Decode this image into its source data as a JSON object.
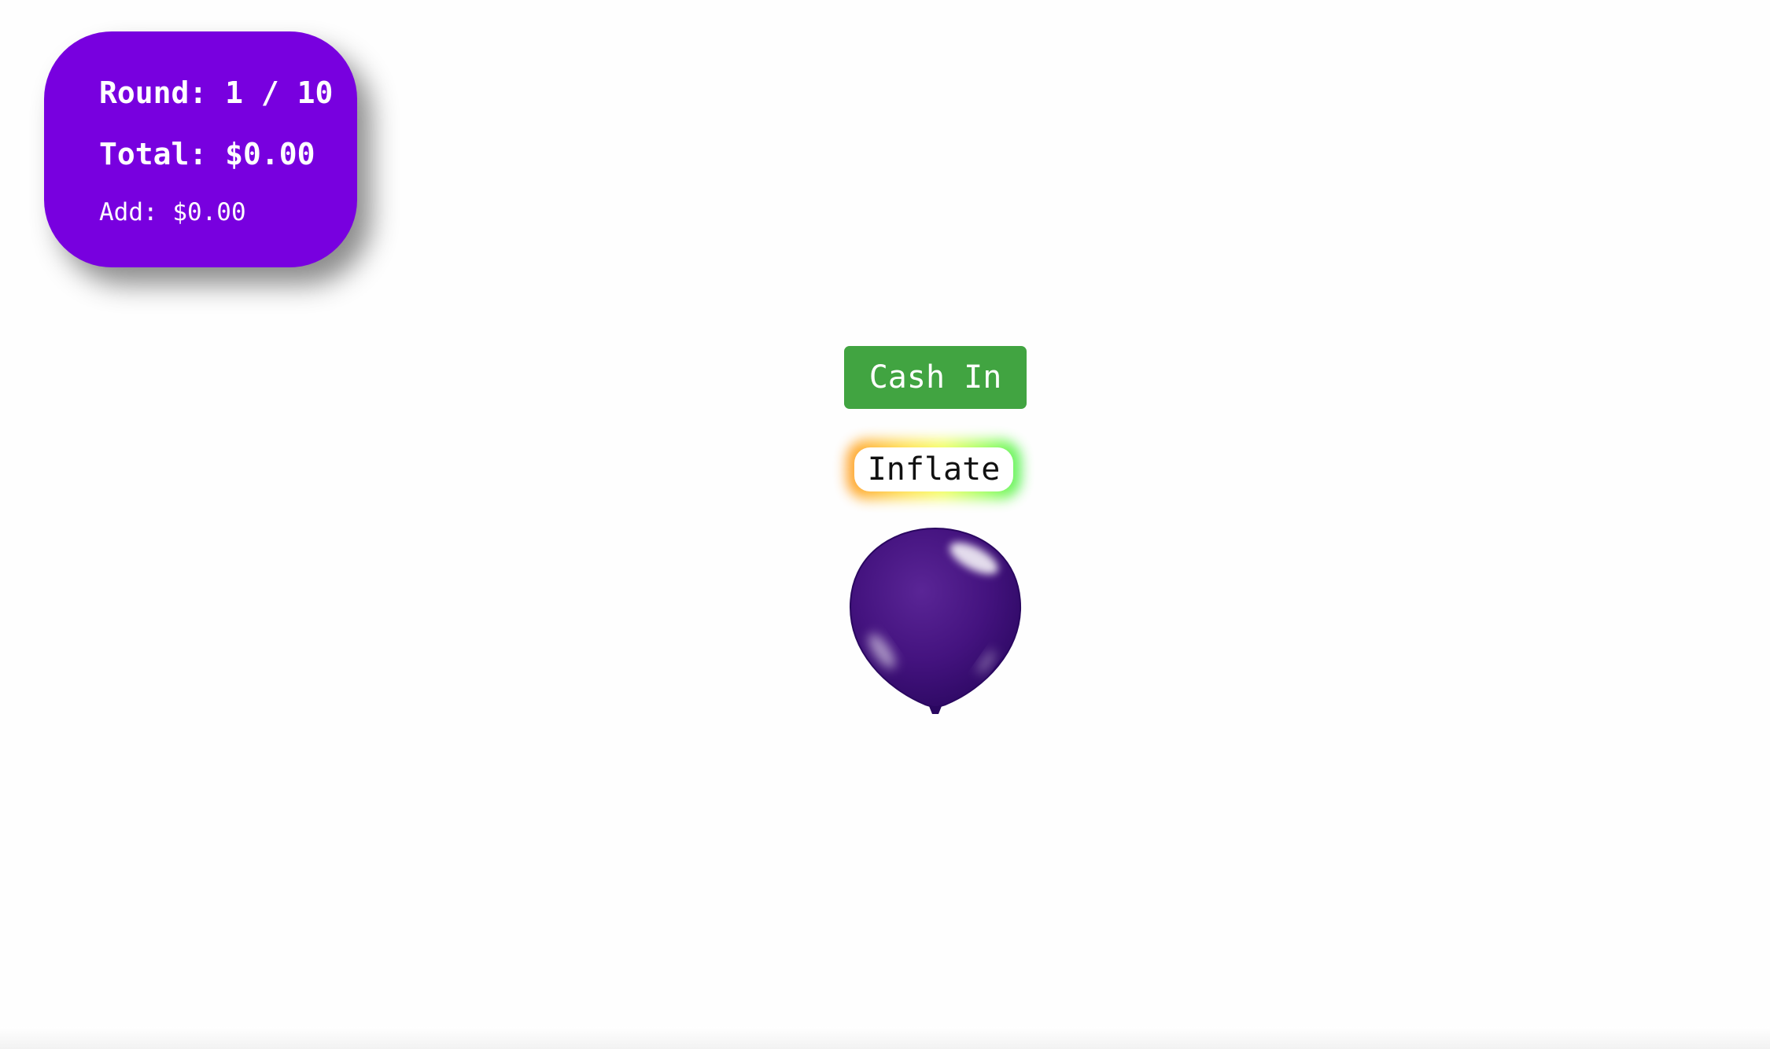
{
  "hud": {
    "round": "Round: 1 / 10",
    "total": "Total: $0.00",
    "add": "Add: $0.00"
  },
  "controls": {
    "cash_in_label": "Cash In",
    "inflate_label": "Inflate"
  },
  "colors": {
    "panel": "#7800df",
    "cash_button": "#41a441",
    "balloon": "#3d0f75"
  },
  "icons": {
    "balloon": "balloon-icon"
  }
}
